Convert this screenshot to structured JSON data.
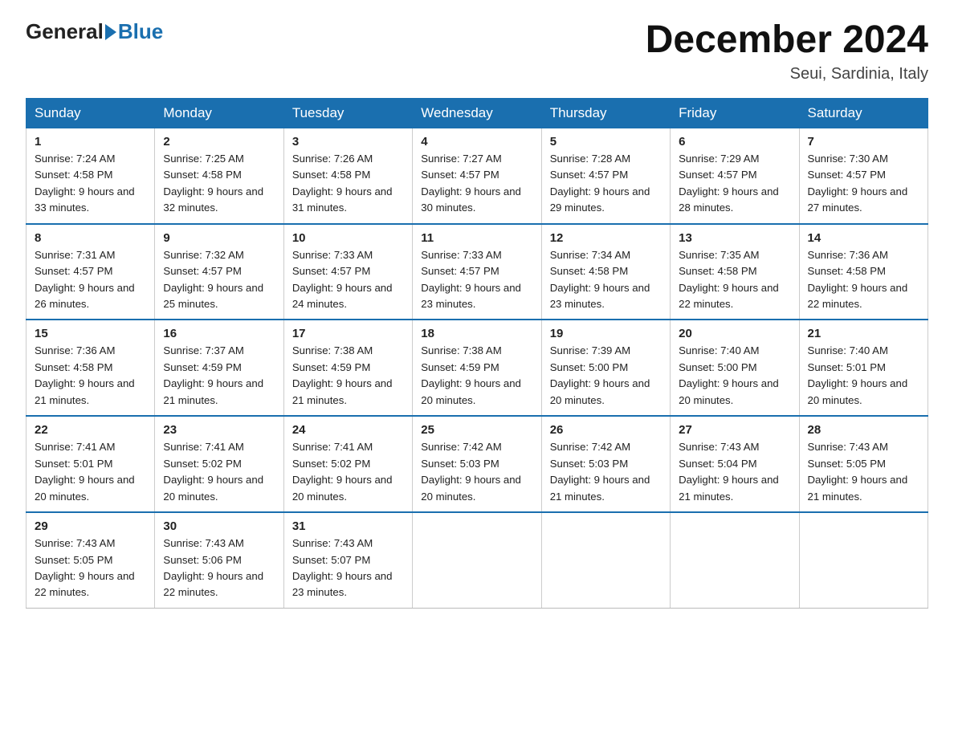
{
  "header": {
    "logo_general": "General",
    "logo_blue": "Blue",
    "title": "December 2024",
    "subtitle": "Seui, Sardinia, Italy"
  },
  "weekdays": [
    "Sunday",
    "Monday",
    "Tuesday",
    "Wednesday",
    "Thursday",
    "Friday",
    "Saturday"
  ],
  "weeks": [
    [
      {
        "day": "1",
        "sunrise": "Sunrise: 7:24 AM",
        "sunset": "Sunset: 4:58 PM",
        "daylight": "Daylight: 9 hours and 33 minutes."
      },
      {
        "day": "2",
        "sunrise": "Sunrise: 7:25 AM",
        "sunset": "Sunset: 4:58 PM",
        "daylight": "Daylight: 9 hours and 32 minutes."
      },
      {
        "day": "3",
        "sunrise": "Sunrise: 7:26 AM",
        "sunset": "Sunset: 4:58 PM",
        "daylight": "Daylight: 9 hours and 31 minutes."
      },
      {
        "day": "4",
        "sunrise": "Sunrise: 7:27 AM",
        "sunset": "Sunset: 4:57 PM",
        "daylight": "Daylight: 9 hours and 30 minutes."
      },
      {
        "day": "5",
        "sunrise": "Sunrise: 7:28 AM",
        "sunset": "Sunset: 4:57 PM",
        "daylight": "Daylight: 9 hours and 29 minutes."
      },
      {
        "day": "6",
        "sunrise": "Sunrise: 7:29 AM",
        "sunset": "Sunset: 4:57 PM",
        "daylight": "Daylight: 9 hours and 28 minutes."
      },
      {
        "day": "7",
        "sunrise": "Sunrise: 7:30 AM",
        "sunset": "Sunset: 4:57 PM",
        "daylight": "Daylight: 9 hours and 27 minutes."
      }
    ],
    [
      {
        "day": "8",
        "sunrise": "Sunrise: 7:31 AM",
        "sunset": "Sunset: 4:57 PM",
        "daylight": "Daylight: 9 hours and 26 minutes."
      },
      {
        "day": "9",
        "sunrise": "Sunrise: 7:32 AM",
        "sunset": "Sunset: 4:57 PM",
        "daylight": "Daylight: 9 hours and 25 minutes."
      },
      {
        "day": "10",
        "sunrise": "Sunrise: 7:33 AM",
        "sunset": "Sunset: 4:57 PM",
        "daylight": "Daylight: 9 hours and 24 minutes."
      },
      {
        "day": "11",
        "sunrise": "Sunrise: 7:33 AM",
        "sunset": "Sunset: 4:57 PM",
        "daylight": "Daylight: 9 hours and 23 minutes."
      },
      {
        "day": "12",
        "sunrise": "Sunrise: 7:34 AM",
        "sunset": "Sunset: 4:58 PM",
        "daylight": "Daylight: 9 hours and 23 minutes."
      },
      {
        "day": "13",
        "sunrise": "Sunrise: 7:35 AM",
        "sunset": "Sunset: 4:58 PM",
        "daylight": "Daylight: 9 hours and 22 minutes."
      },
      {
        "day": "14",
        "sunrise": "Sunrise: 7:36 AM",
        "sunset": "Sunset: 4:58 PM",
        "daylight": "Daylight: 9 hours and 22 minutes."
      }
    ],
    [
      {
        "day": "15",
        "sunrise": "Sunrise: 7:36 AM",
        "sunset": "Sunset: 4:58 PM",
        "daylight": "Daylight: 9 hours and 21 minutes."
      },
      {
        "day": "16",
        "sunrise": "Sunrise: 7:37 AM",
        "sunset": "Sunset: 4:59 PM",
        "daylight": "Daylight: 9 hours and 21 minutes."
      },
      {
        "day": "17",
        "sunrise": "Sunrise: 7:38 AM",
        "sunset": "Sunset: 4:59 PM",
        "daylight": "Daylight: 9 hours and 21 minutes."
      },
      {
        "day": "18",
        "sunrise": "Sunrise: 7:38 AM",
        "sunset": "Sunset: 4:59 PM",
        "daylight": "Daylight: 9 hours and 20 minutes."
      },
      {
        "day": "19",
        "sunrise": "Sunrise: 7:39 AM",
        "sunset": "Sunset: 5:00 PM",
        "daylight": "Daylight: 9 hours and 20 minutes."
      },
      {
        "day": "20",
        "sunrise": "Sunrise: 7:40 AM",
        "sunset": "Sunset: 5:00 PM",
        "daylight": "Daylight: 9 hours and 20 minutes."
      },
      {
        "day": "21",
        "sunrise": "Sunrise: 7:40 AM",
        "sunset": "Sunset: 5:01 PM",
        "daylight": "Daylight: 9 hours and 20 minutes."
      }
    ],
    [
      {
        "day": "22",
        "sunrise": "Sunrise: 7:41 AM",
        "sunset": "Sunset: 5:01 PM",
        "daylight": "Daylight: 9 hours and 20 minutes."
      },
      {
        "day": "23",
        "sunrise": "Sunrise: 7:41 AM",
        "sunset": "Sunset: 5:02 PM",
        "daylight": "Daylight: 9 hours and 20 minutes."
      },
      {
        "day": "24",
        "sunrise": "Sunrise: 7:41 AM",
        "sunset": "Sunset: 5:02 PM",
        "daylight": "Daylight: 9 hours and 20 minutes."
      },
      {
        "day": "25",
        "sunrise": "Sunrise: 7:42 AM",
        "sunset": "Sunset: 5:03 PM",
        "daylight": "Daylight: 9 hours and 20 minutes."
      },
      {
        "day": "26",
        "sunrise": "Sunrise: 7:42 AM",
        "sunset": "Sunset: 5:03 PM",
        "daylight": "Daylight: 9 hours and 21 minutes."
      },
      {
        "day": "27",
        "sunrise": "Sunrise: 7:43 AM",
        "sunset": "Sunset: 5:04 PM",
        "daylight": "Daylight: 9 hours and 21 minutes."
      },
      {
        "day": "28",
        "sunrise": "Sunrise: 7:43 AM",
        "sunset": "Sunset: 5:05 PM",
        "daylight": "Daylight: 9 hours and 21 minutes."
      }
    ],
    [
      {
        "day": "29",
        "sunrise": "Sunrise: 7:43 AM",
        "sunset": "Sunset: 5:05 PM",
        "daylight": "Daylight: 9 hours and 22 minutes."
      },
      {
        "day": "30",
        "sunrise": "Sunrise: 7:43 AM",
        "sunset": "Sunset: 5:06 PM",
        "daylight": "Daylight: 9 hours and 22 minutes."
      },
      {
        "day": "31",
        "sunrise": "Sunrise: 7:43 AM",
        "sunset": "Sunset: 5:07 PM",
        "daylight": "Daylight: 9 hours and 23 minutes."
      },
      null,
      null,
      null,
      null
    ]
  ]
}
